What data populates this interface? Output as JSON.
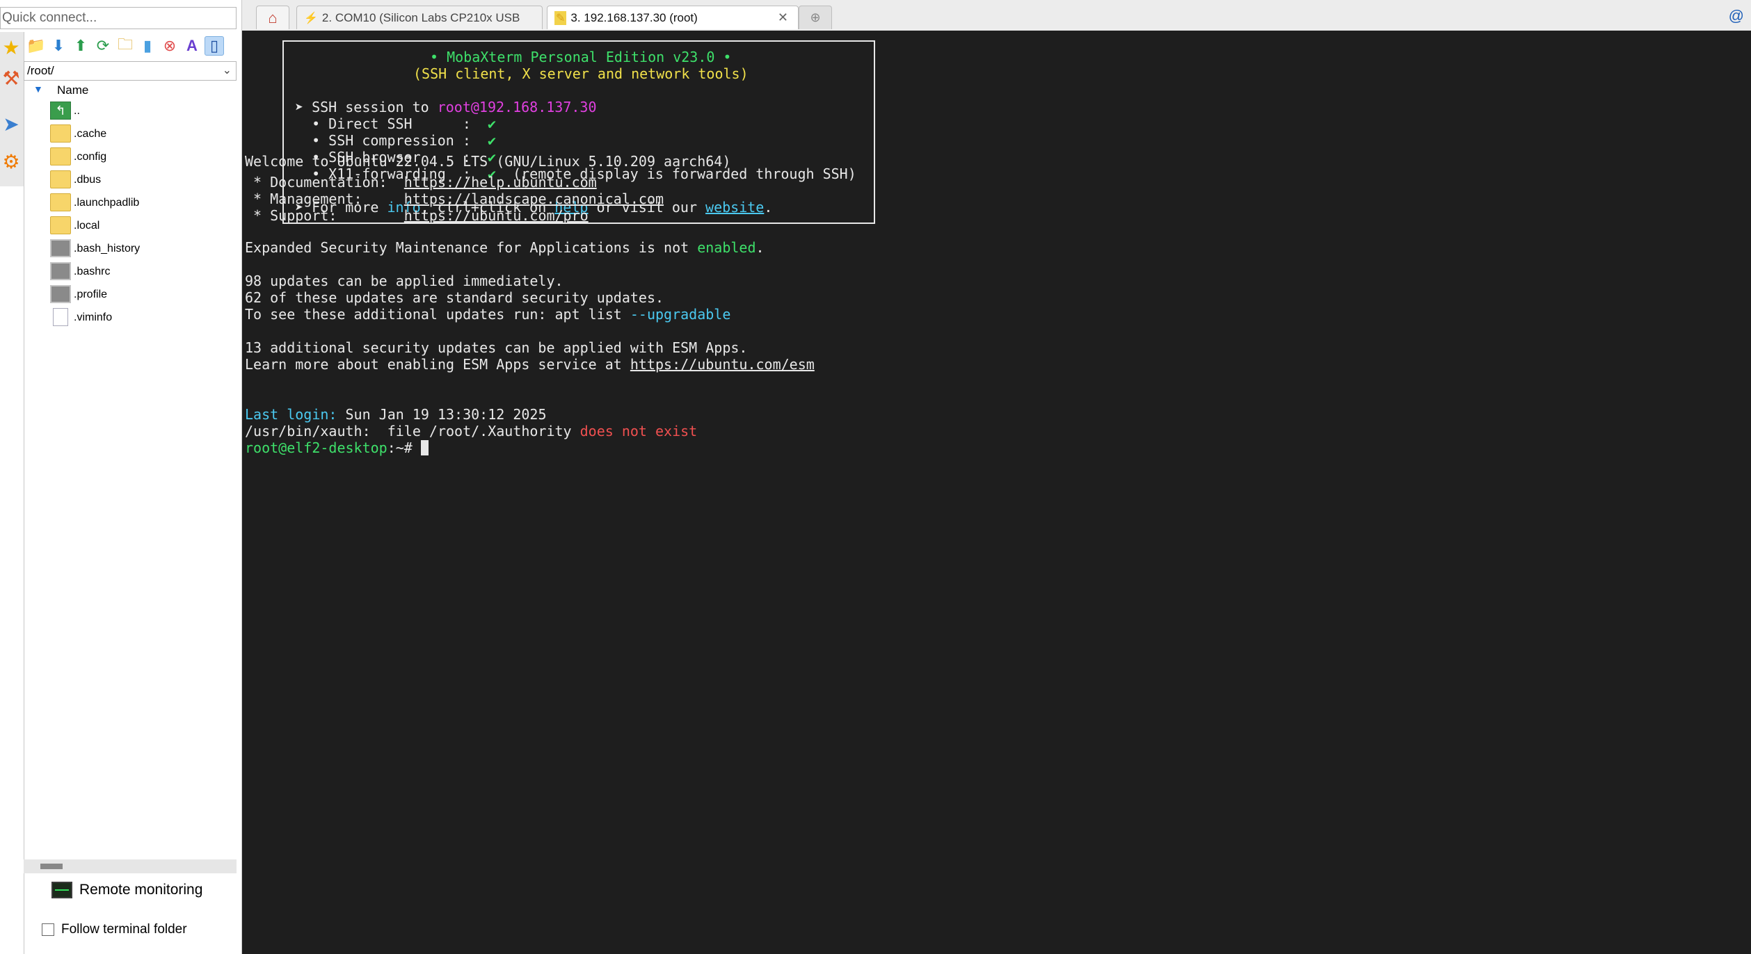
{
  "left": {
    "quick_connect_placeholder": "Quick connect...",
    "path": "/root/",
    "tree_header": "Name",
    "files": [
      {
        "name": "..",
        "kind": "up"
      },
      {
        "name": ".cache",
        "kind": "folder"
      },
      {
        "name": ".config",
        "kind": "folder"
      },
      {
        "name": ".dbus",
        "kind": "folder"
      },
      {
        "name": ".launchpadlib",
        "kind": "folder"
      },
      {
        "name": ".local",
        "kind": "folder"
      },
      {
        "name": ".bash_history",
        "kind": "term"
      },
      {
        "name": ".bashrc",
        "kind": "term"
      },
      {
        "name": ".profile",
        "kind": "term"
      },
      {
        "name": ".viminfo",
        "kind": "doc"
      }
    ],
    "remote_monitoring": "Remote monitoring",
    "follow_terminal_folder": "Follow terminal folder"
  },
  "tabs": [
    {
      "label": "",
      "icon": "home-icon"
    },
    {
      "label": "2. COM10  (Silicon Labs CP210x USB",
      "icon": "serial-icon"
    },
    {
      "label": "3. 192.168.137.30 (root)",
      "icon": "ssh-icon"
    },
    {
      "label": "",
      "icon": "new-tab-icon"
    }
  ],
  "banner": {
    "title": "• MobaXterm Personal Edition v23.0 •",
    "subtitle": "(SSH client, X server and network tools)",
    "ssh_prefix": "➤ SSH session to ",
    "ssh_target": "root@192.168.137.30",
    "opt1": "  • Direct SSH      :  ",
    "opt2": "  • SSH compression :  ",
    "opt3": "  • SSH-browser     :  ",
    "opt4": "  • X11-forwarding  :  ",
    "check": "✔",
    "x11_note": "  (remote display is forwarded through SSH)",
    "more1": "➤ For more ",
    "info": "info",
    "more2": ", ctrl+click on ",
    "help": "help",
    "more3": " or visit our ",
    "website": "website",
    "more4": "."
  },
  "terminal": {
    "welcome": "Welcome to Ubuntu 22.04.5 LTS (GNU/Linux 5.10.209 aarch64)",
    "doc_label": " * Documentation:  ",
    "doc_url": "https://help.ubuntu.com",
    "mgmt_label": " * Management:     ",
    "mgmt_url": "https://landscape.canonical.com",
    "support_label": " * Support:        ",
    "support_url": "https://ubuntu.com/pro",
    "esm1": "Expanded Security Maintenance for Applications is not ",
    "esm1_word": "enabled",
    "esm1_end": ".",
    "upd1": "98 updates can be applied immediately.",
    "upd2": "62 of these updates are standard security updates.",
    "upd3": "To see these additional updates run: apt list ",
    "upd3_flag": "--upgradable",
    "esm2": "13 additional security updates can be applied with ESM Apps.",
    "esm3": "Learn more about enabling ESM Apps service at ",
    "esm3_url": "https://ubuntu.com/esm",
    "last_login_label": "Last login:",
    "last_login_value": " Sun Jan 19 13:30:12 2025",
    "xauth": "/usr/bin/xauth:  file /root/.Xauthority ",
    "xauth_err": "does not exist",
    "prompt_user": "root@elf2-desktop",
    "prompt_path": ":~#",
    "prompt_space": " "
  }
}
